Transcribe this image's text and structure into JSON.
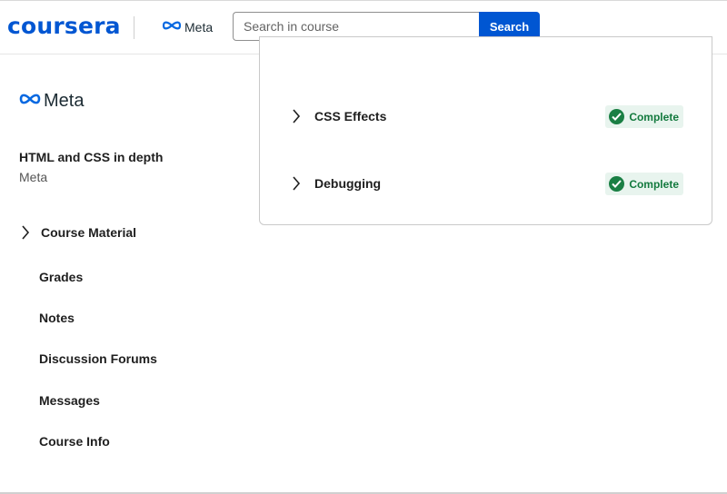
{
  "header": {
    "brand": "coursera",
    "partner_name": "Meta",
    "search": {
      "placeholder": "Search in course",
      "value": ""
    },
    "search_button_label": "Search"
  },
  "sidebar": {
    "partner_name": "Meta",
    "course_title": "HTML and CSS in depth",
    "course_partner": "Meta",
    "course_material_label": "Course Material",
    "nav_items": [
      {
        "label": "Grades"
      },
      {
        "label": "Notes"
      },
      {
        "label": "Discussion Forums"
      },
      {
        "label": "Messages"
      },
      {
        "label": "Course Info"
      }
    ]
  },
  "modules": [
    {
      "title": "CSS Effects",
      "status": "Complete"
    },
    {
      "title": "Debugging",
      "status": "Complete"
    }
  ],
  "colors": {
    "brand_blue": "#0056d2",
    "complete_green": "#137a3e",
    "complete_bg": "#e8f4ee"
  },
  "icons": {
    "meta_logo": "meta-infinity-icon",
    "expand": "chevron-right-icon",
    "complete": "check-circle-icon"
  }
}
